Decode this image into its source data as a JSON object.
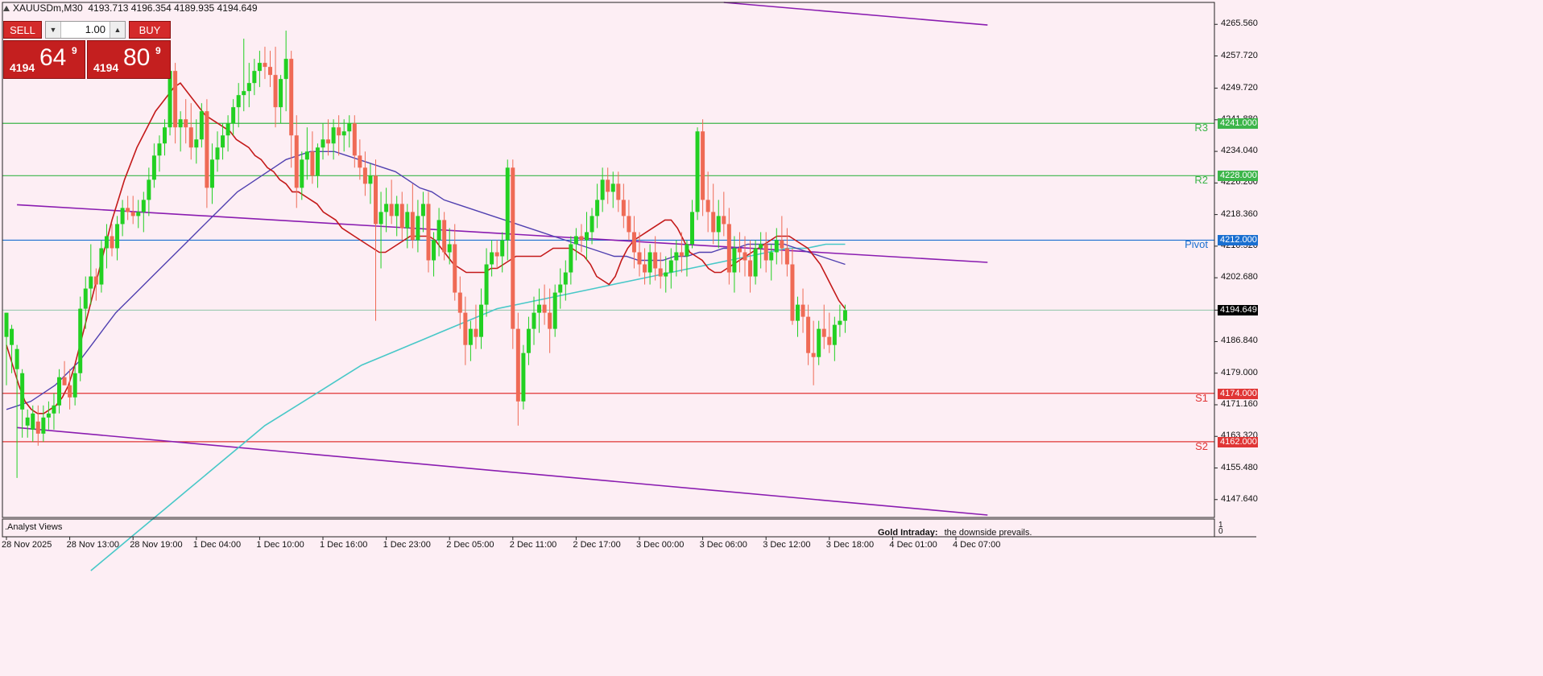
{
  "header": {
    "symbol": "XAUUSDm,M30",
    "ohlc": "4193.713 4196.354 4189.935 4194.649"
  },
  "trade_panel": {
    "sell_label": "SELL",
    "buy_label": "BUY",
    "volume": "1.00",
    "sell_small": "4194",
    "sell_big": "64",
    "sell_sup": "9",
    "buy_small": "4194",
    "buy_big": "80",
    "buy_sup": "9"
  },
  "price_axis": {
    "ticks": [
      "4265.560",
      "4257.720",
      "4249.720",
      "4241.880",
      "4234.040",
      "4226.200",
      "4218.360",
      "4210.520",
      "4202.680",
      "4194.649",
      "4186.840",
      "4179.000",
      "4171.160",
      "4163.320",
      "4155.480",
      "4147.640"
    ],
    "current_price": "4194.649"
  },
  "levels": [
    {
      "name": "R3",
      "value": 4241.0,
      "label": "4241.000",
      "color": "#3cb54a"
    },
    {
      "name": "R2",
      "value": 4228.0,
      "label": "4228.000",
      "color": "#3cb54a"
    },
    {
      "name": "Pivot",
      "value": 4212.0,
      "label": "4212.000",
      "color": "#1a6fd0"
    },
    {
      "name": "S1",
      "value": 4174.0,
      "label": "4174.000",
      "color": "#e03535"
    },
    {
      "name": "S2",
      "value": 4162.0,
      "label": "4162.000",
      "color": "#e03535"
    }
  ],
  "time_axis": [
    "28 Nov 2025",
    "28 Nov 13:00",
    "28 Nov 19:00",
    "1 Dec 04:00",
    "1 Dec 10:00",
    "1 Dec 16:00",
    "1 Dec 23:00",
    "2 Dec 05:00",
    "2 Dec 11:00",
    "2 Dec 17:00",
    "3 Dec 00:00",
    "3 Dec 06:00",
    "3 Dec 12:00",
    "3 Dec 18:00",
    "4 Dec 01:00",
    "4 Dec 07:00"
  ],
  "subwindow": {
    "title": ".Analyst Views",
    "scale_top": "1",
    "scale_bottom": "0",
    "gold_label": "Gold Intraday:",
    "gold_text": "the downside prevails."
  },
  "colors": {
    "background": "#fdeef4",
    "bull": "#22d022",
    "bear": "#ef6a55",
    "ma_fast": "#c41a1a",
    "ma_mid": "#5040b0",
    "ma_slow": "#48c8c8",
    "channel": "#8a1cb0"
  },
  "chart_data": {
    "type": "candlestick",
    "symbol": "XAUUSDm",
    "timeframe": "M30",
    "ylim": [
      4143.2,
      4271.0
    ],
    "xlim": [
      0,
      189
    ],
    "x_tick_bars": [
      0,
      12,
      24,
      36,
      48,
      60,
      72,
      84,
      96,
      108,
      120,
      132,
      144,
      156,
      168,
      180
    ],
    "candles": [
      [
        4188,
        4194,
        4176,
        4194
      ],
      [
        4186,
        4191,
        4179,
        4190
      ],
      [
        4180,
        4186,
        4153,
        4185
      ],
      [
        4170,
        4180,
        4163,
        4179
      ],
      [
        4166,
        4170,
        4163,
        4168
      ],
      [
        4165,
        4171,
        4162,
        4169
      ],
      [
        4167,
        4171,
        4161,
        4164
      ],
      [
        4164,
        4171,
        4162,
        4168
      ],
      [
        4168,
        4172,
        4165,
        4169
      ],
      [
        4169,
        4174,
        4165,
        4171
      ],
      [
        4171,
        4180,
        4169,
        4178
      ],
      [
        4178,
        4182,
        4176,
        4176
      ],
      [
        4176,
        4180,
        4170,
        4173
      ],
      [
        4173,
        4181,
        4171,
        4179
      ],
      [
        4179,
        4198,
        4177,
        4195
      ],
      [
        4195,
        4203,
        4190,
        4200
      ],
      [
        4200,
        4211,
        4196,
        4203
      ],
      [
        4203,
        4205,
        4197,
        4201
      ],
      [
        4201,
        4212,
        4199,
        4210
      ],
      [
        4210,
        4216,
        4205,
        4213
      ],
      [
        4213,
        4216,
        4208,
        4210
      ],
      [
        4210,
        4218,
        4207,
        4216
      ],
      [
        4216,
        4222,
        4213,
        4220
      ],
      [
        4220,
        4223,
        4217,
        4219
      ],
      [
        4219,
        4223,
        4216,
        4218
      ],
      [
        4218,
        4222,
        4215,
        4219
      ],
      [
        4219,
        4224,
        4214,
        4222
      ],
      [
        4222,
        4230,
        4218,
        4227
      ],
      [
        4227,
        4236,
        4225,
        4233
      ],
      [
        4233,
        4238,
        4229,
        4236
      ],
      [
        4236,
        4242,
        4233,
        4240
      ],
      [
        4240,
        4256,
        4238,
        4254
      ],
      [
        4254,
        4256,
        4236,
        4240
      ],
      [
        4240,
        4244,
        4234,
        4242
      ],
      [
        4242,
        4247,
        4236,
        4240
      ],
      [
        4240,
        4246,
        4232,
        4235
      ],
      [
        4235,
        4242,
        4231,
        4237
      ],
      [
        4237,
        4246,
        4235,
        4244
      ],
      [
        4244,
        4247,
        4220,
        4225
      ],
      [
        4225,
        4236,
        4221,
        4232
      ],
      [
        4232,
        4239,
        4229,
        4235
      ],
      [
        4235,
        4241,
        4232,
        4238
      ],
      [
        4238,
        4243,
        4234,
        4241
      ],
      [
        4241,
        4247,
        4238,
        4245
      ],
      [
        4245,
        4251,
        4240,
        4248
      ],
      [
        4248,
        4262,
        4244,
        4249
      ],
      [
        4249,
        4256,
        4245,
        4251
      ],
      [
        4251,
        4257,
        4248,
        4254
      ],
      [
        4254,
        4259,
        4250,
        4256
      ],
      [
        4256,
        4260,
        4252,
        4255
      ],
      [
        4255,
        4259,
        4250,
        4253
      ],
      [
        4253,
        4260,
        4240,
        4245
      ],
      [
        4245,
        4253,
        4241,
        4252
      ],
      [
        4252,
        4264,
        4244,
        4257
      ],
      [
        4257,
        4259,
        4230,
        4238
      ],
      [
        4238,
        4243,
        4220,
        4225
      ],
      [
        4225,
        4234,
        4222,
        4232
      ],
      [
        4232,
        4240,
        4227,
        4234
      ],
      [
        4234,
        4239,
        4226,
        4228
      ],
      [
        4228,
        4236,
        4225,
        4235
      ],
      [
        4235,
        4241,
        4232,
        4237
      ],
      [
        4237,
        4242,
        4233,
        4236
      ],
      [
        4236,
        4242,
        4232,
        4240
      ],
      [
        4240,
        4243,
        4233,
        4238
      ],
      [
        4238,
        4242,
        4234,
        4239
      ],
      [
        4239,
        4243,
        4235,
        4241
      ],
      [
        4241,
        4243,
        4230,
        4233
      ],
      [
        4233,
        4237,
        4227,
        4230
      ],
      [
        4230,
        4234,
        4223,
        4226
      ],
      [
        4226,
        4231,
        4221,
        4228
      ],
      [
        4228,
        4232,
        4192,
        4216
      ],
      [
        4216,
        4224,
        4205,
        4219
      ],
      [
        4219,
        4225,
        4214,
        4221
      ],
      [
        4221,
        4227,
        4216,
        4218
      ],
      [
        4218,
        4223,
        4213,
        4221
      ],
      [
        4221,
        4224,
        4212,
        4215
      ],
      [
        4215,
        4221,
        4210,
        4219
      ],
      [
        4219,
        4226,
        4210,
        4212
      ],
      [
        4212,
        4222,
        4209,
        4218
      ],
      [
        4218,
        4224,
        4214,
        4221
      ],
      [
        4221,
        4224,
        4204,
        4207
      ],
      [
        4207,
        4214,
        4203,
        4212
      ],
      [
        4212,
        4220,
        4208,
        4217
      ],
      [
        4217,
        4219,
        4207,
        4209
      ],
      [
        4209,
        4215,
        4206,
        4211
      ],
      [
        4211,
        4216,
        4197,
        4199
      ],
      [
        4199,
        4203,
        4190,
        4194
      ],
      [
        4194,
        4198,
        4181,
        4186
      ],
      [
        4186,
        4192,
        4182,
        4190
      ],
      [
        4190,
        4196,
        4185,
        4188
      ],
      [
        4188,
        4200,
        4185,
        4196
      ],
      [
        4196,
        4210,
        4193,
        4206
      ],
      [
        4206,
        4212,
        4203,
        4209
      ],
      [
        4209,
        4212,
        4205,
        4208
      ],
      [
        4208,
        4214,
        4204,
        4212
      ],
      [
        4212,
        4232,
        4207,
        4230
      ],
      [
        4230,
        4232,
        4185,
        4190
      ],
      [
        4190,
        4194,
        4166,
        4172
      ],
      [
        4172,
        4186,
        4170,
        4184
      ],
      [
        4184,
        4193,
        4181,
        4190
      ],
      [
        4190,
        4198,
        4186,
        4194
      ],
      [
        4194,
        4200,
        4189,
        4196
      ],
      [
        4196,
        4201,
        4191,
        4194
      ],
      [
        4194,
        4200,
        4184,
        4190
      ],
      [
        4190,
        4201,
        4188,
        4199
      ],
      [
        4199,
        4205,
        4195,
        4201
      ],
      [
        4201,
        4207,
        4197,
        4204
      ],
      [
        4204,
        4213,
        4201,
        4211
      ],
      [
        4211,
        4215,
        4207,
        4213
      ],
      [
        4213,
        4216,
        4209,
        4212
      ],
      [
        4212,
        4219,
        4207,
        4214
      ],
      [
        4214,
        4220,
        4211,
        4218
      ],
      [
        4218,
        4226,
        4215,
        4222
      ],
      [
        4222,
        4230,
        4219,
        4227
      ],
      [
        4227,
        4230,
        4221,
        4224
      ],
      [
        4224,
        4229,
        4220,
        4226
      ],
      [
        4226,
        4229,
        4219,
        4222
      ],
      [
        4222,
        4226,
        4215,
        4218
      ],
      [
        4218,
        4222,
        4212,
        4214
      ],
      [
        4214,
        4218,
        4205,
        4209
      ],
      [
        4209,
        4214,
        4203,
        4206
      ],
      [
        4206,
        4210,
        4201,
        4204
      ],
      [
        4204,
        4211,
        4201,
        4209
      ],
      [
        4209,
        4213,
        4202,
        4205
      ],
      [
        4205,
        4209,
        4200,
        4203
      ],
      [
        4203,
        4208,
        4199,
        4204
      ],
      [
        4204,
        4210,
        4200,
        4207
      ],
      [
        4207,
        4212,
        4203,
        4209
      ],
      [
        4209,
        4214,
        4204,
        4208
      ],
      [
        4208,
        4212,
        4203,
        4211
      ],
      [
        4211,
        4222,
        4210,
        4219
      ],
      [
        4219,
        4240,
        4217,
        4239
      ],
      [
        4239,
        4242,
        4218,
        4222
      ],
      [
        4222,
        4229,
        4214,
        4219
      ],
      [
        4219,
        4226,
        4211,
        4214
      ],
      [
        4214,
        4222,
        4210,
        4218
      ],
      [
        4218,
        4224,
        4213,
        4216
      ],
      [
        4216,
        4220,
        4201,
        4204
      ],
      [
        4204,
        4213,
        4199,
        4210
      ],
      [
        4210,
        4214,
        4204,
        4209
      ],
      [
        4209,
        4213,
        4203,
        4207
      ],
      [
        4207,
        4212,
        4199,
        4203
      ],
      [
        4203,
        4212,
        4201,
        4210
      ],
      [
        4210,
        4214,
        4205,
        4211
      ],
      [
        4211,
        4214,
        4204,
        4207
      ],
      [
        4207,
        4211,
        4202,
        4209
      ],
      [
        4209,
        4215,
        4206,
        4212
      ],
      [
        4212,
        4218,
        4206,
        4210
      ],
      [
        4210,
        4215,
        4203,
        4206
      ],
      [
        4206,
        4210,
        4191,
        4192
      ],
      [
        4192,
        4198,
        4188,
        4196
      ],
      [
        4196,
        4200,
        4189,
        4193
      ],
      [
        4193,
        4196,
        4181,
        4184
      ],
      [
        4184,
        4192,
        4176,
        4183
      ],
      [
        4183,
        4192,
        4181,
        4190
      ],
      [
        4190,
        4196,
        4185,
        4188
      ],
      [
        4188,
        4194,
        4184,
        4186
      ],
      [
        4186,
        4193,
        4182,
        4191
      ],
      [
        4191,
        4196,
        4188,
        4192
      ],
      [
        4192,
        4196,
        4189,
        4194.6
      ]
    ],
    "ma_fast": [
      4186,
      4181,
      4176,
      4172,
      4170,
      4169,
      4169,
      4170,
      4171,
      4173,
      4176,
      4181,
      4187,
      4193,
      4199,
      4205,
      4211,
      4217,
      4222,
      4227,
      4231,
      4235,
      4238,
      4241,
      4244,
      4246,
      4248,
      4250,
      4251,
      4249,
      4247,
      4245,
      4243,
      4242,
      4241,
      4240,
      4239,
      4237,
      4236,
      4235,
      4233,
      4232,
      4230,
      4229,
      4227,
      4226,
      4224,
      4224,
      4223,
      4222,
      4221,
      4219,
      4218,
      4217,
      4215,
      4214,
      4213,
      4212,
      4211,
      4210,
      4209,
      4209,
      4210,
      4211,
      4212,
      4213,
      4213,
      4213,
      4213,
      4212,
      4210,
      4208,
      4206,
      4205,
      4204,
      4204,
      4204,
      4204,
      4205,
      4205,
      4206,
      4207,
      4208,
      4208,
      4208,
      4208,
      4208,
      4209,
      4210,
      4210,
      4210,
      4210,
      4209,
      4208,
      4206,
      4203,
      4202,
      4201,
      4203,
      4207,
      4210,
      4212,
      4213,
      4214,
      4215,
      4216,
      4217,
      4217,
      4215,
      4212,
      4209,
      4208,
      4207,
      4205,
      4204,
      4204,
      4205,
      4206,
      4207,
      4208,
      4209,
      4210,
      4211,
      4212,
      4213,
      4213,
      4213,
      4212,
      4211,
      4210,
      4208,
      4206,
      4203,
      4200,
      4197,
      4195
    ],
    "ma_mid": [
      4170,
      4171,
      4172,
      4174,
      4176,
      4179,
      4182,
      4186,
      4190,
      4194,
      4197,
      4200,
      4203,
      4206,
      4209,
      4212,
      4215,
      4218,
      4221,
      4224,
      4226,
      4228,
      4230,
      4232,
      4233,
      4234,
      4234,
      4234,
      4233,
      4232,
      4231,
      4230,
      4229,
      4227,
      4225,
      4224,
      4222,
      4221,
      4220,
      4219,
      4218,
      4217,
      4216,
      4215,
      4214,
      4213,
      4212,
      4211,
      4210,
      4209,
      4208,
      4208,
      4207,
      4207,
      4207,
      4208,
      4208,
      4209,
      4209,
      4210,
      4210,
      4211,
      4211,
      4211,
      4211,
      4210,
      4209,
      4208,
      4207,
      4206
    ],
    "ma_slow": [
      4130,
      4134,
      4138,
      4142,
      4146,
      4150,
      4154,
      4158,
      4162,
      4166,
      4169,
      4172,
      4175,
      4178,
      4181,
      4183,
      4185,
      4187,
      4189,
      4191,
      4193,
      4195,
      4196,
      4197,
      4198,
      4199,
      4200,
      4201,
      4202,
      4203,
      4204,
      4205,
      4206,
      4207,
      4208,
      4209,
      4210,
      4210,
      4211,
      4211
    ],
    "channel": [
      {
        "x": [
          2,
          186
        ],
        "y": [
          4220.8,
          4206.5
        ]
      },
      {
        "x": [
          2,
          186
        ],
        "y": [
          4165.5,
          4143.8
        ]
      },
      {
        "x": [
          136,
          186
        ],
        "y": [
          4271.0,
          4265.4
        ]
      }
    ]
  }
}
